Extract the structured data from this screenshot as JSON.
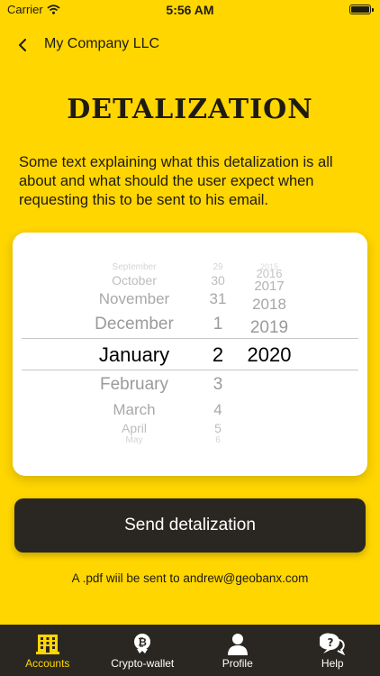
{
  "status": {
    "carrier": "Carrier",
    "time": "5:56 AM"
  },
  "nav": {
    "title": "My Company LLC"
  },
  "page": {
    "title": "DETALIZATION",
    "description": "Some text explaining what this detalization is all about and what should the user expect when requesting this to be sent to his email."
  },
  "picker": {
    "months": [
      "September",
      "October",
      "November",
      "December",
      "January",
      "February",
      "March",
      "April",
      "May"
    ],
    "days": [
      "29",
      "30",
      "31",
      "1",
      "2",
      "3",
      "4",
      "5",
      "6"
    ],
    "years": [
      "2015",
      "2016",
      "2017",
      "2018",
      "2019",
      "2020"
    ],
    "selected": {
      "month": "January",
      "day": "2",
      "year": "2020"
    }
  },
  "actions": {
    "send_label": "Send detalization",
    "note": "A .pdf wiil be sent to andrew@geobanx.com"
  },
  "tabs": [
    {
      "label": "Accounts",
      "icon": "building-icon",
      "active": true
    },
    {
      "label": "Crypto-wallet",
      "icon": "bitcoin-icon",
      "active": false
    },
    {
      "label": "Profile",
      "icon": "person-icon",
      "active": false
    },
    {
      "label": "Help",
      "icon": "question-chat-icon",
      "active": false
    }
  ],
  "colors": {
    "accent": "#FFD600",
    "dark": "#2a2722",
    "text": "#1e1b12"
  }
}
